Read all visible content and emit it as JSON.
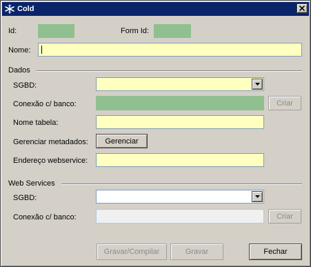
{
  "window": {
    "title": "Cold",
    "icon": "cold-app-icon",
    "close_icon": "close-icon"
  },
  "header": {
    "id_label": "Id:",
    "id_value": "",
    "form_id_label": "Form Id:",
    "form_id_value": "",
    "nome_label": "Nome:",
    "nome_value": ""
  },
  "dados": {
    "title": "Dados",
    "sgbd_label": "SGBD:",
    "sgbd_value": "",
    "conexao_label": "Conexão c/ banco:",
    "conexao_value": "",
    "criar_label": "Criar",
    "nome_tabela_label": "Nome tabela:",
    "nome_tabela_value": "",
    "gerenciar_metadados_label": "Gerenciar metadados:",
    "gerenciar_button": "Gerenciar",
    "endereco_label": "Endereço webservice:",
    "endereco_value": ""
  },
  "web_services": {
    "title": "Web Services",
    "sgbd_label": "SGBD:",
    "sgbd_value": "",
    "conexao_label": "Conexão c/ banco:",
    "conexao_value": "",
    "criar_label": "Criar"
  },
  "footer": {
    "gravar_compilar": "Gravar/Compilar",
    "gravar": "Gravar",
    "fechar": "Fechar"
  },
  "colors": {
    "title_bar": "#0a246a",
    "window_bg": "#d4d0c8",
    "required_field": "#ffffc0",
    "readonly_field": "#90c090"
  }
}
